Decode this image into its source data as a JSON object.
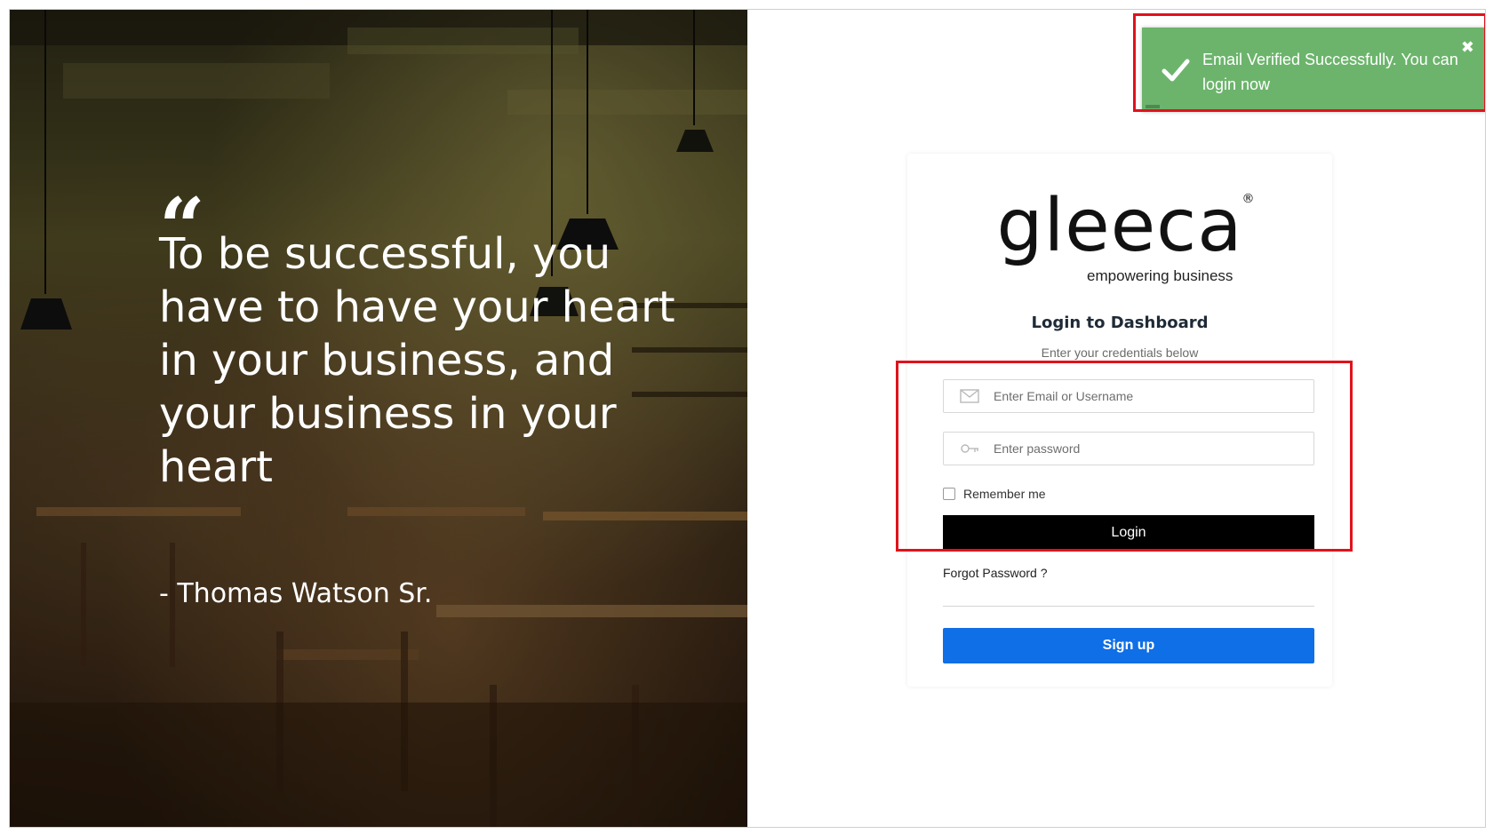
{
  "hero": {
    "quote_mark": "“",
    "quote": "To be successful, you have to have your heart in your business, and your business in your heart",
    "author": "- Thomas Watson Sr."
  },
  "logo": {
    "word": "gleeca",
    "registered": "®",
    "tagline": "empowering business"
  },
  "login": {
    "title": "Login to Dashboard",
    "subtitle": "Enter your credentials below",
    "email_placeholder": "Enter Email or Username",
    "email_value": "",
    "password_placeholder": "Enter password",
    "password_value": "",
    "remember_label": "Remember me",
    "remember_checked": false,
    "login_button": "Login",
    "forgot_link": "Forgot Password ?",
    "signup_button": "Sign up"
  },
  "toast": {
    "message": "Email Verified Successfully. You can login now",
    "close": "✖",
    "type": "success",
    "icon": "checkmark-icon"
  },
  "colors": {
    "toast_success": "#6cb46c",
    "login_button": "#000000",
    "signup_button": "#0f6fe6",
    "highlight": "#e0121b"
  }
}
